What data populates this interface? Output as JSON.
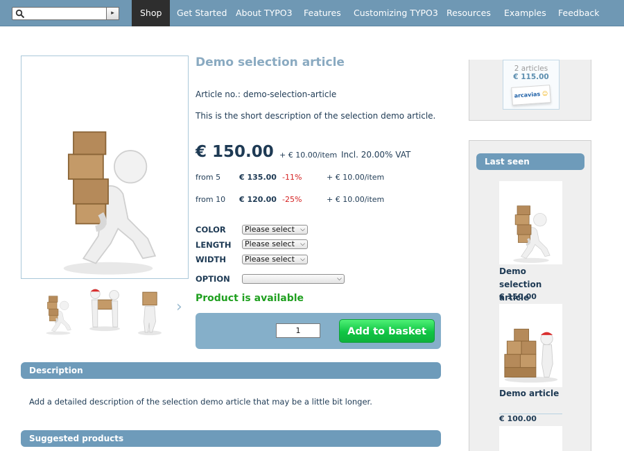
{
  "nav": {
    "search_go": "▸",
    "items": [
      "Shop",
      "Get Started",
      "About TYPO3",
      "Features",
      "Customizing TYPO3",
      "Resources",
      "Examples",
      "Feedback"
    ]
  },
  "product": {
    "title": "Demo selection article",
    "article_no": "Article no.: demo-selection-article",
    "short_description": "This is the short description of the selection demo article.",
    "price": "€ 150.00",
    "shipping": "+ € 10.00/item",
    "vat": "Incl. 20.00% VAT",
    "tiers": [
      {
        "from": "from 5",
        "price": "€ 135.00",
        "discount": "-11%",
        "shipping": "+ € 10.00/item"
      },
      {
        "from": "from 10",
        "price": "€ 120.00",
        "discount": "-25%",
        "shipping": "+ € 10.00/item"
      }
    ],
    "attributes": [
      {
        "label": "COLOR",
        "value": "Please select"
      },
      {
        "label": "LENGTH",
        "value": "Please select"
      },
      {
        "label": "WIDTH",
        "value": "Please select"
      }
    ],
    "option_label": "OPTION",
    "option_value": "",
    "availability": "Product is available",
    "quantity": "1",
    "add_to_basket": "Add to basket",
    "thumb_next": "›"
  },
  "sections": {
    "description_title": "Description",
    "description_text": "Add a detailed description of the selection demo article that may be a little bit longer.",
    "suggested_title": "Suggested products"
  },
  "cart": {
    "count": "2 articles",
    "total": "€ 115.00",
    "logo_text": "arcavias",
    "logo_dot": "☺"
  },
  "last_seen": {
    "title": "Last seen",
    "items": [
      {
        "name": "Demo selection article",
        "price": "€ 150.00"
      },
      {
        "name": "Demo article",
        "price": "€ 100.00"
      }
    ]
  },
  "colors": {
    "nav_bg": "#6f98b4",
    "accent_bar": "#6e9bba",
    "available": "#20a020",
    "discount": "#d42020",
    "add_button": "#10c544"
  }
}
